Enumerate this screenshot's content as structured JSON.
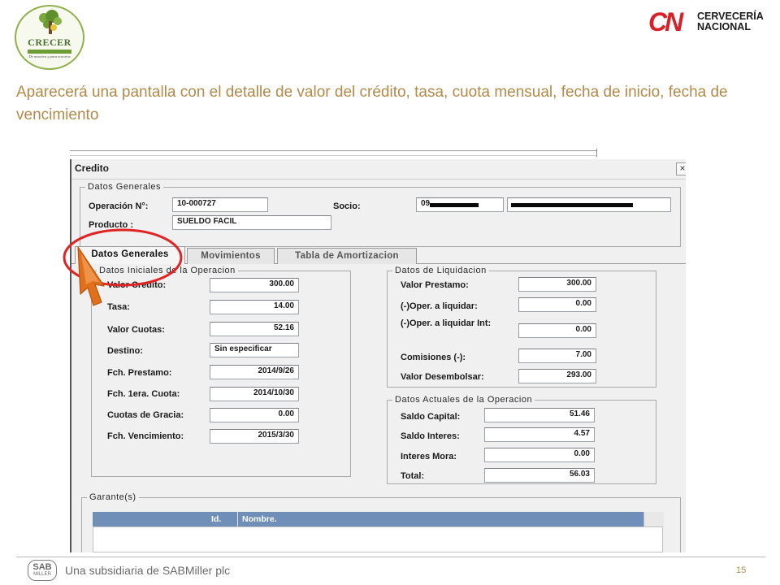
{
  "brand": {
    "left_logo": {
      "word": "CRECER",
      "tagline": "De nosotros y para nosotros"
    },
    "right_logo": {
      "mark": "CN",
      "line1": "CERVECERÍA",
      "line2": "NACIONAL"
    }
  },
  "intro_text": "Aparecerá una pantalla con el detalle de valor del crédito, tasa, cuota mensual, fecha de inicio, fecha de vencimiento",
  "window": {
    "title": "Credito",
    "close_glyph": "×",
    "header_group": {
      "legend": "Datos Generales",
      "operacion_label": "Operación N°:",
      "operacion_value": "10-000727",
      "producto_label": "Producto :",
      "producto_value": "SUELDO FACIL",
      "socio_label": "Socio:",
      "socio_value_prefix": "09"
    },
    "tabs": [
      {
        "label": "Datos Generales",
        "active": true
      },
      {
        "label": "Movimientos",
        "active": false
      },
      {
        "label": "Tabla de Amortizacion",
        "active": false
      }
    ],
    "iniciales": {
      "legend": "Datos Iniciales de la Operacion",
      "rows": [
        {
          "label": "Valor Credito:",
          "value": "300.00"
        },
        {
          "label": "Tasa:",
          "value": "14.00"
        },
        {
          "label": "Valor Cuotas:",
          "value": "52.16"
        },
        {
          "label": "Destino:",
          "value": "Sin especificar"
        },
        {
          "label": "Fch. Prestamo:",
          "value": "2014/9/26"
        },
        {
          "label": "Fch. 1era. Cuota:",
          "value": "2014/10/30"
        },
        {
          "label": "Cuotas de Gracia:",
          "value": "0.00"
        },
        {
          "label": "Fch. Vencimiento:",
          "value": "2015/3/30"
        }
      ]
    },
    "liquidacion": {
      "legend": "Datos de Liquidacion",
      "rows": [
        {
          "label": "Valor Prestamo:",
          "value": "300.00"
        },
        {
          "label": "(-)Oper. a liquidar:",
          "value": "0.00"
        },
        {
          "label": "(-)Oper. a liquidar Int:",
          "value": "0.00"
        },
        {
          "label": "Comisiones (-):",
          "value": "7.00"
        },
        {
          "label": "Valor Desembolsar:",
          "value": "293.00"
        }
      ]
    },
    "actuales": {
      "legend": "Datos Actuales de la Operacion",
      "rows": [
        {
          "label": "Saldo Capital:",
          "value": "51.46"
        },
        {
          "label": "Saldo Interes:",
          "value": "4.57"
        },
        {
          "label": "Interes Mora:",
          "value": "0.00"
        },
        {
          "label": "Total:",
          "value": "56.03"
        }
      ]
    },
    "garantes": {
      "legend": "Garante(s)",
      "columns": [
        "Id.",
        "Nombre."
      ]
    }
  },
  "annotation": {
    "circle_color": "#e02424",
    "arrow_color": "#e0701c"
  },
  "footer": {
    "logo_top": "SAB",
    "logo_bottom": "MILLER",
    "text": "Una subsidiaria de SABMiller plc",
    "page": "15"
  }
}
